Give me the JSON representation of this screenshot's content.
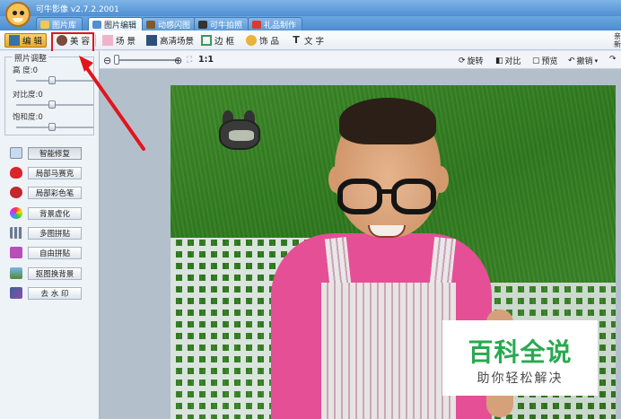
{
  "app": {
    "title": "可牛影像 v2.7.2.2001"
  },
  "main_tabs": [
    {
      "label": "图片库",
      "icon": "image-library-icon",
      "active": false
    },
    {
      "label": "图片编辑",
      "icon": "image-edit-icon",
      "active": true
    },
    {
      "label": "动感闪图",
      "icon": "flash-image-icon",
      "active": false
    },
    {
      "label": "可牛拍照",
      "icon": "camera-icon",
      "active": false
    },
    {
      "label": "礼品制作",
      "icon": "gift-icon",
      "active": false
    }
  ],
  "sub_tools": [
    {
      "label": "编 辑",
      "icon": "edit-icon",
      "active": true
    },
    {
      "label": "美 容",
      "icon": "beauty-icon",
      "active": false,
      "highlighted": true
    },
    {
      "label": "场 景",
      "icon": "scene-icon",
      "active": false
    },
    {
      "label": "高清场景",
      "icon": "hd-scene-icon",
      "active": false
    },
    {
      "label": "边 框",
      "icon": "frame-icon",
      "active": false
    },
    {
      "label": "饰 品",
      "icon": "decoration-icon",
      "active": false
    },
    {
      "label": "文 字",
      "icon": "text-icon",
      "active": false
    }
  ],
  "adjust": {
    "title": "照片调整",
    "items": [
      {
        "label": "高   度",
        "value": "0"
      },
      {
        "label": "对比度",
        "value": "0"
      },
      {
        "label": "饱和度",
        "value": "0"
      }
    ]
  },
  "tools": [
    {
      "label": "智能修复",
      "icon": "smart-repair-icon",
      "pressed": true
    },
    {
      "label": "局部马赛克",
      "icon": "mosaic-icon",
      "pressed": false
    },
    {
      "label": "局部彩色笔",
      "icon": "color-pen-icon",
      "pressed": false
    },
    {
      "label": "背景虚化",
      "icon": "blur-background-icon",
      "pressed": false
    },
    {
      "label": "多图拼贴",
      "icon": "multi-collage-icon",
      "pressed": false
    },
    {
      "label": "自由拼贴",
      "icon": "free-collage-icon",
      "pressed": false
    },
    {
      "label": "抠图换背景",
      "icon": "cutout-icon",
      "pressed": false
    },
    {
      "label": "去 水 印",
      "icon": "remove-watermark-icon",
      "pressed": false
    }
  ],
  "canvas_toolbar": {
    "ratio": "1:1",
    "rotate": "旋转",
    "compare": "对比",
    "preview": "预览",
    "undo": "撤销"
  },
  "watermark": {
    "title": "百科全说",
    "subtitle": "助你轻松解决"
  },
  "right_edge_text": "亲新",
  "colors": {
    "highlight": "#e0161c",
    "arrow": "#e0161c",
    "watermark_green": "#29a94f",
    "accent_blue": "#4f8fd2"
  }
}
